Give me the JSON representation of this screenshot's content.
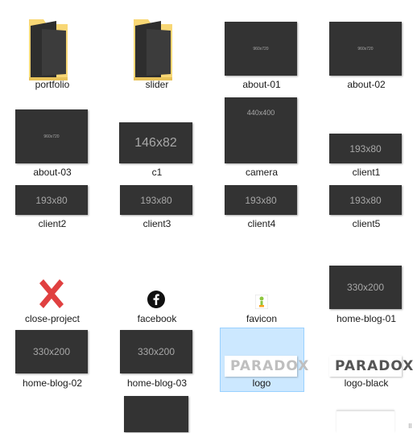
{
  "items": {
    "portfolio": {
      "label": "portfolio",
      "type": "folder"
    },
    "slider": {
      "label": "slider",
      "type": "folder"
    },
    "about01": {
      "label": "about-01",
      "thumb": "960x720"
    },
    "about02": {
      "label": "about-02",
      "thumb": "960x720"
    },
    "about03": {
      "label": "about-03",
      "thumb": "960x720"
    },
    "c1": {
      "label": "c1",
      "thumb": "146x82"
    },
    "camera": {
      "label": "camera",
      "thumb": "440x400"
    },
    "client1": {
      "label": "client1",
      "thumb": "193x80"
    },
    "client2": {
      "label": "client2",
      "thumb": "193x80"
    },
    "client3": {
      "label": "client3",
      "thumb": "193x80"
    },
    "client4": {
      "label": "client4",
      "thumb": "193x80"
    },
    "client5": {
      "label": "client5",
      "thumb": "193x80"
    },
    "closeProject": {
      "label": "close-project",
      "icon": "close-x-icon"
    },
    "facebook": {
      "label": "facebook",
      "icon": "facebook-icon"
    },
    "favicon": {
      "label": "favicon",
      "icon": "paradox-pin-icon"
    },
    "homeBlog01": {
      "label": "home-blog-01",
      "thumb": "330x200"
    },
    "homeBlog02": {
      "label": "home-blog-02",
      "thumb": "330x200"
    },
    "homeBlog03": {
      "label": "home-blog-03",
      "thumb": "330x200"
    },
    "logo": {
      "label": "logo",
      "logo_text": "PARADOX",
      "selected": true
    },
    "logoBlack": {
      "label": "logo-black",
      "logo_text": "PARADOX"
    }
  },
  "colors": {
    "tile": "#333333",
    "selection": "#cce8ff",
    "folder": "#f8d775",
    "close": "#e04040",
    "logo_green": "#8dc63f",
    "logo_orange": "#f7a21b",
    "logo_gray": "#bfbfbf"
  }
}
